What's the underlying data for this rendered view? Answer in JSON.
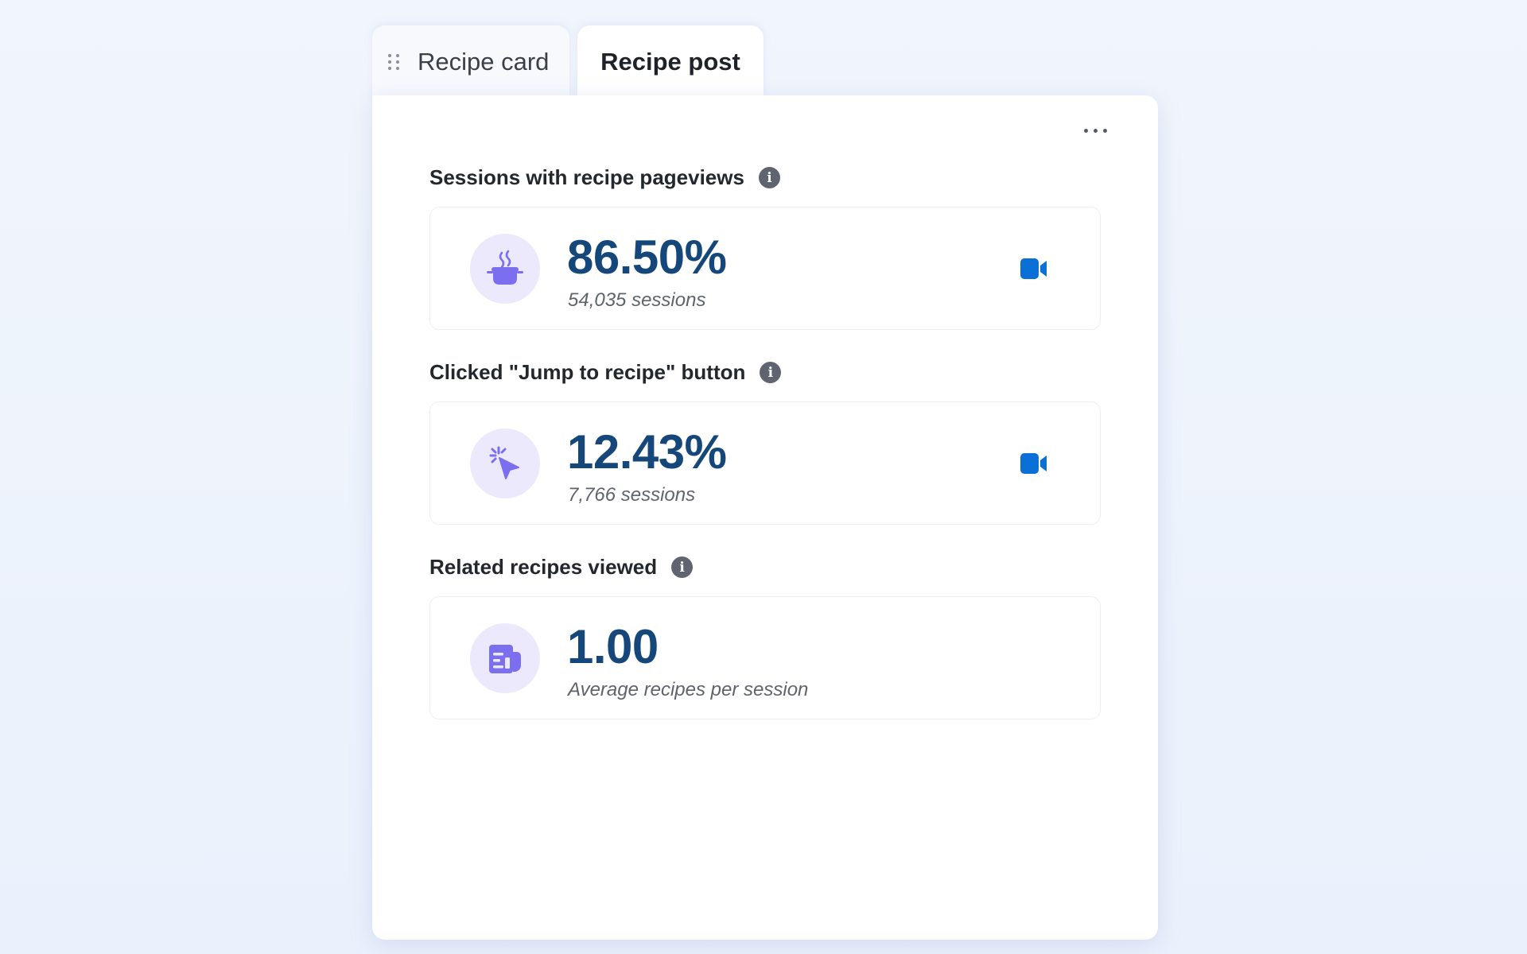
{
  "tabs": [
    {
      "label": "Recipe card",
      "active": false
    },
    {
      "label": "Recipe post",
      "active": true
    }
  ],
  "accent_color": "#16477a",
  "icon_accent_color": "#7b6ff0",
  "metrics": [
    {
      "title": "Sessions with recipe pageviews",
      "value": "86.50%",
      "subtext": "54,035 sessions",
      "icon": "cooking-pot-icon",
      "has_video": true
    },
    {
      "title": "Clicked \"Jump to recipe\" button",
      "value": "12.43%",
      "subtext": "7,766 sessions",
      "icon": "click-pointer-icon",
      "has_video": true
    },
    {
      "title": "Related recipes viewed",
      "value": "1.00",
      "subtext": "Average recipes per session",
      "icon": "recipe-document-icon",
      "has_video": false
    }
  ]
}
